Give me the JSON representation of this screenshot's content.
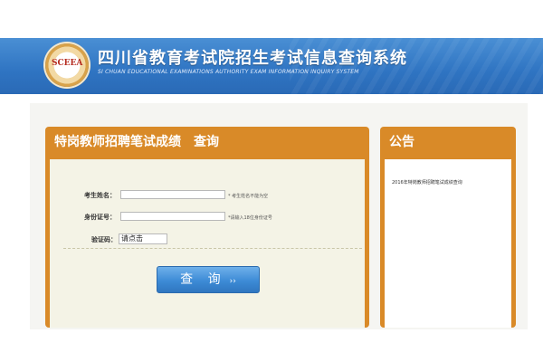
{
  "header": {
    "title": "四川省教育考试院招生考试信息查询系统",
    "subtitle": "SI CHUAN EDUCATIONAL EXAMINATIONS AUTHORITY EXAM INFORMATION INQUIRY SYSTEM",
    "logo_text": "SCEEA"
  },
  "query_panel": {
    "title": "特岗教师招聘笔试成绩　查询",
    "name_label": "考生姓名：",
    "name_value": "",
    "name_hint": "* 考生姓名不能为空",
    "id_label": "身份证号：",
    "id_value": "",
    "id_hint": "*请输入18位身份证号",
    "captcha_label": "验证码：",
    "captcha_value": "请点击",
    "button_label": "查 询",
    "button_arrow": "››"
  },
  "notice_panel": {
    "title": "公告",
    "items": [
      "2016年特岗教师招聘笔试成绩查询"
    ]
  },
  "colors": {
    "header_blue": "#2f74c2",
    "panel_orange": "#d98a28",
    "button_blue": "#3d8bd6"
  }
}
